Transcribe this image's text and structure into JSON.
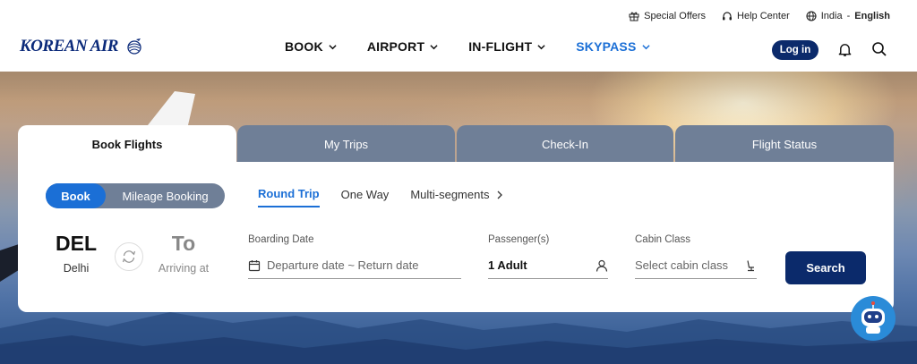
{
  "utility": {
    "special_offers": "Special Offers",
    "help_center": "Help Center",
    "region": "India",
    "separator": "-",
    "language": "English"
  },
  "brand": {
    "logo_text": "KOREAN AIR"
  },
  "nav": {
    "items": [
      {
        "label": "BOOK",
        "active": false
      },
      {
        "label": "AIRPORT",
        "active": false
      },
      {
        "label": "IN-FLIGHT",
        "active": false
      },
      {
        "label": "SKYPASS",
        "active": true
      }
    ]
  },
  "header": {
    "login_label": "Log in"
  },
  "tabs": [
    "Book Flights",
    "My Trips",
    "Check-In",
    "Flight Status"
  ],
  "booking": {
    "mode_book": "Book",
    "mode_mileage": "Mileage Booking",
    "trip_types": [
      "Round Trip",
      "One Way",
      "Multi-segments"
    ],
    "from_code": "DEL",
    "from_city": "Delhi",
    "to_code": "To",
    "to_city": "Arriving at",
    "date_label": "Boarding Date",
    "date_placeholder": "Departure date ~ Return date",
    "passenger_label": "Passenger(s)",
    "passenger_value": "1 Adult",
    "cabin_label": "Cabin Class",
    "cabin_placeholder": "Select cabin class",
    "search_label": "Search"
  },
  "colors": {
    "brand_navy": "#0b2a6b",
    "accent_blue": "#1b6fd6",
    "tab_inactive": "#6f7f97"
  },
  "icons": [
    "gift-icon",
    "headset-icon",
    "globe-icon",
    "chevron-down-icon",
    "bell-icon",
    "search-icon",
    "swap-icon",
    "calendar-icon",
    "person-icon",
    "seat-icon",
    "chatbot-icon"
  ]
}
